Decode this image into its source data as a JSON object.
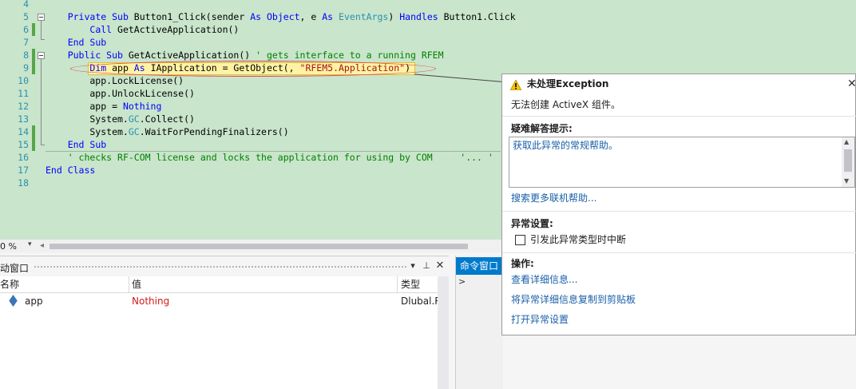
{
  "editor": {
    "line_numbers": [
      "4",
      "5",
      "6",
      "7",
      "8",
      "9",
      "10",
      "11",
      "12",
      "13",
      "14",
      "15",
      "16",
      "17",
      "18"
    ],
    "lines": [
      [],
      [
        {
          "t": "    "
        },
        {
          "k": "kw",
          "t": "Private Sub"
        },
        {
          "t": " Button1_Click(sender "
        },
        {
          "k": "kw",
          "t": "As"
        },
        {
          "t": " "
        },
        {
          "k": "kw",
          "t": "Object"
        },
        {
          "t": ", e "
        },
        {
          "k": "kw",
          "t": "As"
        },
        {
          "t": " "
        },
        {
          "k": "ty",
          "t": "EventArgs"
        },
        {
          "t": ") "
        },
        {
          "k": "kw",
          "t": "Handles"
        },
        {
          "t": " Button1.Click"
        }
      ],
      [
        {
          "t": "        "
        },
        {
          "k": "kw",
          "t": "Call"
        },
        {
          "t": " GetActiveApplication()"
        }
      ],
      [
        {
          "t": "    "
        },
        {
          "k": "kw",
          "t": "End Sub"
        }
      ],
      [
        {
          "t": "    "
        },
        {
          "k": "kw",
          "t": "Public Sub"
        },
        {
          "t": " GetActiveApplication() "
        },
        {
          "k": "cm",
          "t": "' gets interface to a running RFEM"
        }
      ],
      [
        {
          "t": "        "
        },
        {
          "k": "kw",
          "t": "Dim"
        },
        {
          "t": " app "
        },
        {
          "k": "kw",
          "t": "As"
        },
        {
          "t": " IApplication = GetObject(, "
        },
        {
          "k": "st",
          "t": "\"RFEM5.Application\""
        },
        {
          "t": ")"
        }
      ],
      [
        {
          "t": "        app.LockLicense()"
        }
      ],
      [
        {
          "t": "        app.UnlockLicense()"
        }
      ],
      [
        {
          "t": "        app = "
        },
        {
          "k": "kw",
          "t": "Nothing"
        }
      ],
      [
        {
          "t": "        System."
        },
        {
          "k": "ty",
          "t": "GC"
        },
        {
          "t": ".Collect()"
        }
      ],
      [
        {
          "t": "        System."
        },
        {
          "k": "ty",
          "t": "GC"
        },
        {
          "t": ".WaitForPendingFinalizers()"
        }
      ],
      [
        {
          "t": "    "
        },
        {
          "k": "kw",
          "t": "End Sub"
        }
      ],
      [
        {
          "t": "    "
        },
        {
          "k": "cm",
          "t": "' checks RF-COM license and locks the application for using by COM     '... '"
        }
      ],
      [
        {
          "k": "kw",
          "t": "End Class"
        }
      ],
      []
    ],
    "zoom": "0 %"
  },
  "locals": {
    "title": "动窗口",
    "columns": {
      "name": "名称",
      "value": "值",
      "type": "类型"
    },
    "rows": [
      {
        "name": "app",
        "value": "Nothing",
        "type": "Dlubal.R"
      }
    ],
    "value_color": "#d11b1b"
  },
  "command_window": {
    "tab": "命令窗口",
    "prompt": ">"
  },
  "exception": {
    "title": "未处理Exception",
    "message": "无法创建 ActiveX 组件。",
    "tips_heading": "疑难解答提示:",
    "tip_link": "获取此异常的常规帮助。",
    "search_link": "搜索更多联机帮助...",
    "settings_heading": "异常设置:",
    "break_checkbox_label": "引发此异常类型时中断",
    "break_checked": false,
    "actions_heading": "操作:",
    "action_details": "查看详细信息...",
    "action_copy": "将异常详细信息复制到剪贴板",
    "action_settings": "打开异常设置"
  },
  "colors": {
    "editor_bg": "#c9e5cb",
    "keyword": "#0000ff",
    "type": "#2b91af",
    "string": "#a31515",
    "comment": "#008000",
    "accent": "#007acc"
  }
}
